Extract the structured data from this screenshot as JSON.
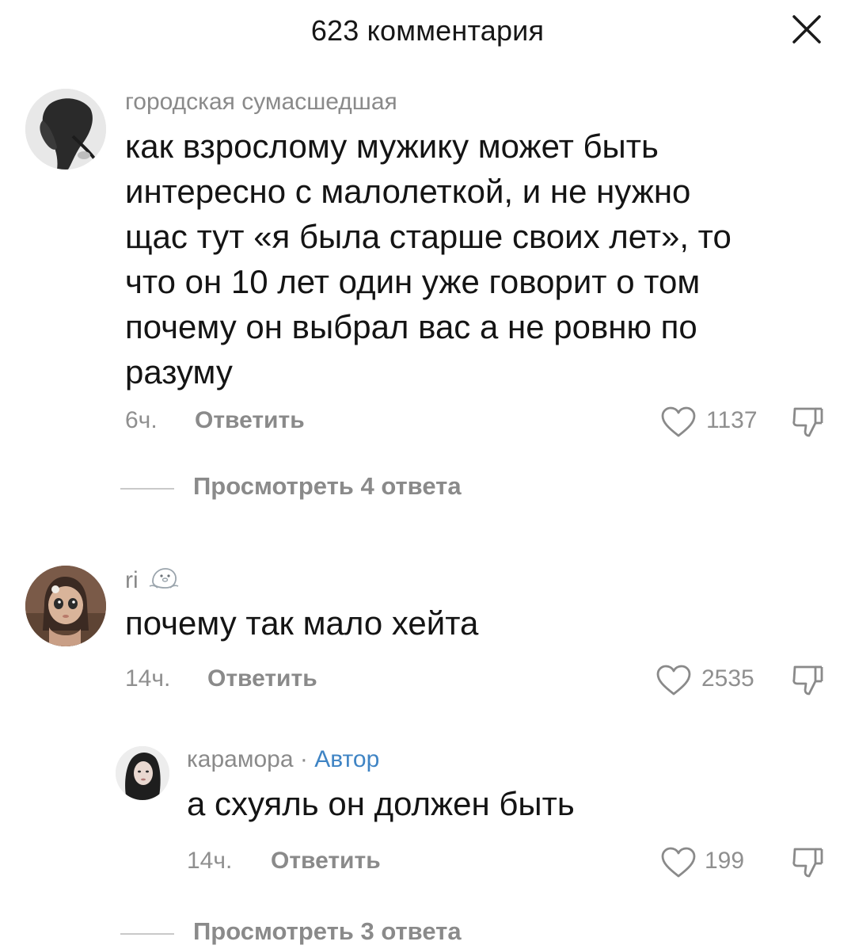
{
  "header": {
    "title": "623 комментария"
  },
  "comments": [
    {
      "username": "городская сумасшедшая",
      "text_lines": [
        "как взрослому мужику может быть",
        "интересно с малолеткой, и не нужно",
        "щас тут «я была старше своих лет», то",
        "что он 10 лет один уже говорит о том",
        "почему он выбрал вас а не ровню по",
        "разуму"
      ],
      "time": "6ч.",
      "reply_label": "Ответить",
      "likes": "1137",
      "view_replies": "Просмотреть 4 ответа"
    },
    {
      "username": "ri",
      "text_lines": [
        "почему так мало хейта"
      ],
      "time": "14ч.",
      "reply_label": "Ответить",
      "likes": "2535"
    },
    {
      "username": "карамора",
      "separator": " · ",
      "author_label": "Автор",
      "text_lines": [
        "а схуяль он должен быть"
      ],
      "time": "14ч.",
      "reply_label": "Ответить",
      "likes": "199",
      "view_replies": "Просмотреть 3 ответа"
    }
  ],
  "colors": {
    "text": "#141414",
    "secondary": "#8a8a8a",
    "author_accent": "#3f84c4",
    "background": "#ffffff"
  },
  "icons": {
    "close": "close-icon",
    "like": "heart-outline-icon",
    "dislike": "thumbs-down-icon",
    "seal_emoji": "seal-emoji-icon"
  }
}
